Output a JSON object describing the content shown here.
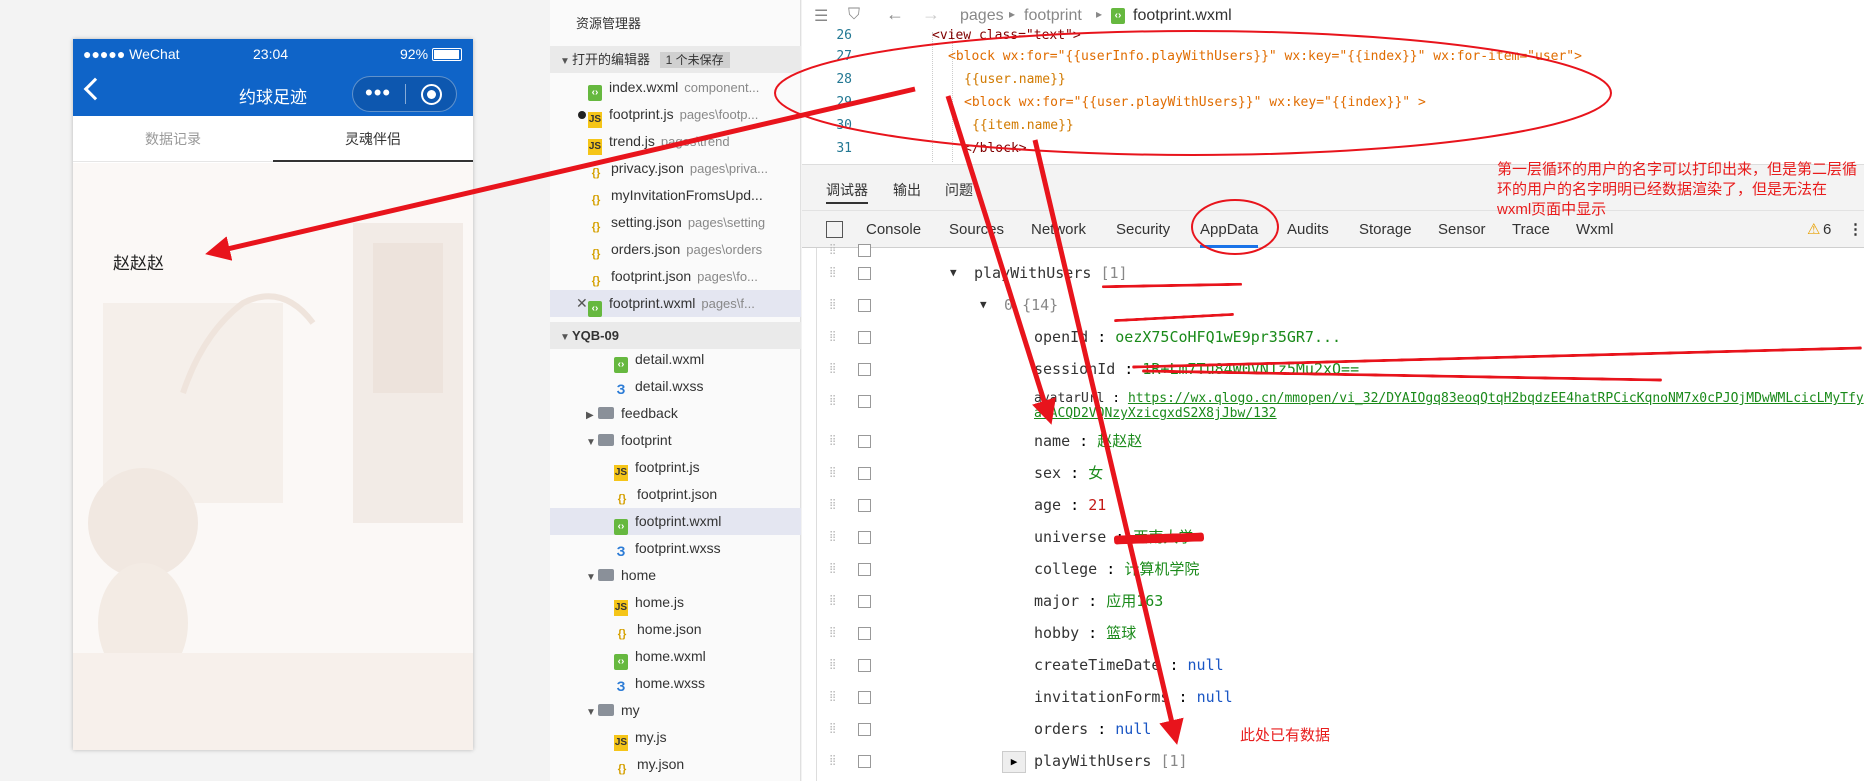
{
  "phone": {
    "status": {
      "signal": "●●●●● WeChat",
      "time": "23:04",
      "battery": "92%"
    },
    "nav": {
      "title": "约球足迹"
    },
    "tabs": [
      {
        "label": "数据记录"
      },
      {
        "label": "灵魂伴侣"
      }
    ],
    "name_text": "赵赵赵"
  },
  "explorer": {
    "title": "资源管理器",
    "open_editors": "打开的编辑器",
    "unsaved": "1 个未保存",
    "open_files": [
      {
        "name": "index.wxml",
        "path": "component...",
        "type": "wxml"
      },
      {
        "name": "footprint.js",
        "path": "pages\\footp...",
        "type": "js"
      },
      {
        "name": "trend.js",
        "path": "pages\\trend",
        "type": "js"
      },
      {
        "name": "privacy.json",
        "path": "pages\\priva...",
        "type": "json"
      },
      {
        "name": "myInvitationFromsUpd...",
        "path": "",
        "type": "json"
      },
      {
        "name": "setting.json",
        "path": "pages\\setting",
        "type": "json"
      },
      {
        "name": "orders.json",
        "path": "pages\\orders",
        "type": "json"
      },
      {
        "name": "footprint.json",
        "path": "pages\\fo...",
        "type": "json"
      },
      {
        "name": "footprint.wxml",
        "path": "pages\\f...",
        "type": "wxml"
      }
    ],
    "project": "YQB-09",
    "tree": [
      {
        "name": "detail.wxml",
        "type": "wxml"
      },
      {
        "name": "detail.wxss",
        "type": "wxss"
      },
      {
        "name": "feedback",
        "type": "folder"
      },
      {
        "name": "footprint",
        "type": "folder"
      },
      {
        "name": "footprint.js",
        "type": "js"
      },
      {
        "name": "footprint.json",
        "type": "json"
      },
      {
        "name": "footprint.wxml",
        "type": "wxml"
      },
      {
        "name": "footprint.wxss",
        "type": "wxss"
      },
      {
        "name": "home",
        "type": "folder"
      },
      {
        "name": "home.js",
        "type": "js"
      },
      {
        "name": "home.json",
        "type": "json"
      },
      {
        "name": "home.wxml",
        "type": "wxml"
      },
      {
        "name": "home.wxss",
        "type": "wxss"
      },
      {
        "name": "my",
        "type": "folder"
      },
      {
        "name": "my.js",
        "type": "js"
      },
      {
        "name": "my.json",
        "type": "json"
      }
    ]
  },
  "editor": {
    "breadcrumb": [
      "pages",
      "footprint",
      "footprint.wxml"
    ],
    "lines": [
      {
        "num": "26",
        "code": "<view class=\"text\">"
      },
      {
        "num": "27",
        "code": "<block wx:for=\"{{userInfo.playWithUsers}}\" wx:key=\"{{index}}\" wx:for-item=\"user\">"
      },
      {
        "num": "28",
        "code": "{{user.name}}"
      },
      {
        "num": "29",
        "code": "<block wx:for=\"{{user.playWithUsers}}\" wx:key=\"{{index}}\" >"
      },
      {
        "num": "30",
        "code": "{{item.name}}"
      },
      {
        "num": "31",
        "code": "</block>"
      }
    ]
  },
  "devtools": {
    "top_tabs": [
      "调试器",
      "输出",
      "问题"
    ],
    "tabs": [
      "Console",
      "Sources",
      "Network",
      "Security",
      "AppData",
      "Audits",
      "Storage",
      "Sensor",
      "Trace",
      "Wxml"
    ],
    "warnings": "6",
    "tree": [
      {
        "key": "playWithUsers",
        "val": "[1]"
      },
      {
        "key": "0",
        "val": "{14}"
      },
      {
        "key": "openId",
        "val": "oezX75CoHFQ1wE9pr35GR7..."
      },
      {
        "key": "sessionId",
        "val": "1R+Lm7Tu84W0VN1z5Mu2xQ=="
      },
      {
        "key": "avatarUrl",
        "val": "https://wx.qlogo.cn/mmopen/vi_32/DYAIOgq83eoqQtqH2bqdzEE4hatRPCicKqnoNM7x0cPJOjMDwWMLcicLMyTfya4ACQD2VQNzyXzicgxdS2X8jJbw/132"
      },
      {
        "key": "name",
        "val": "赵赵赵"
      },
      {
        "key": "sex",
        "val": "女"
      },
      {
        "key": "age",
        "val": "21"
      },
      {
        "key": "universe",
        "val": "西南大学"
      },
      {
        "key": "college",
        "val": "计算机学院"
      },
      {
        "key": "major",
        "val": "应用163"
      },
      {
        "key": "hobby",
        "val": "篮球"
      },
      {
        "key": "createTimeDate",
        "val": "null"
      },
      {
        "key": "invitationForms",
        "val": "null"
      },
      {
        "key": "orders",
        "val": "null"
      },
      {
        "key": "playWithUsers",
        "val": "[1]"
      }
    ]
  },
  "annotations": {
    "note_main": "第一层循环的用户的名字可以打印出来，但是第二层循环的用户的名字明明已经数据渲染了，但是无法在wxml页面中显示",
    "note_data": "此处已有数据"
  }
}
